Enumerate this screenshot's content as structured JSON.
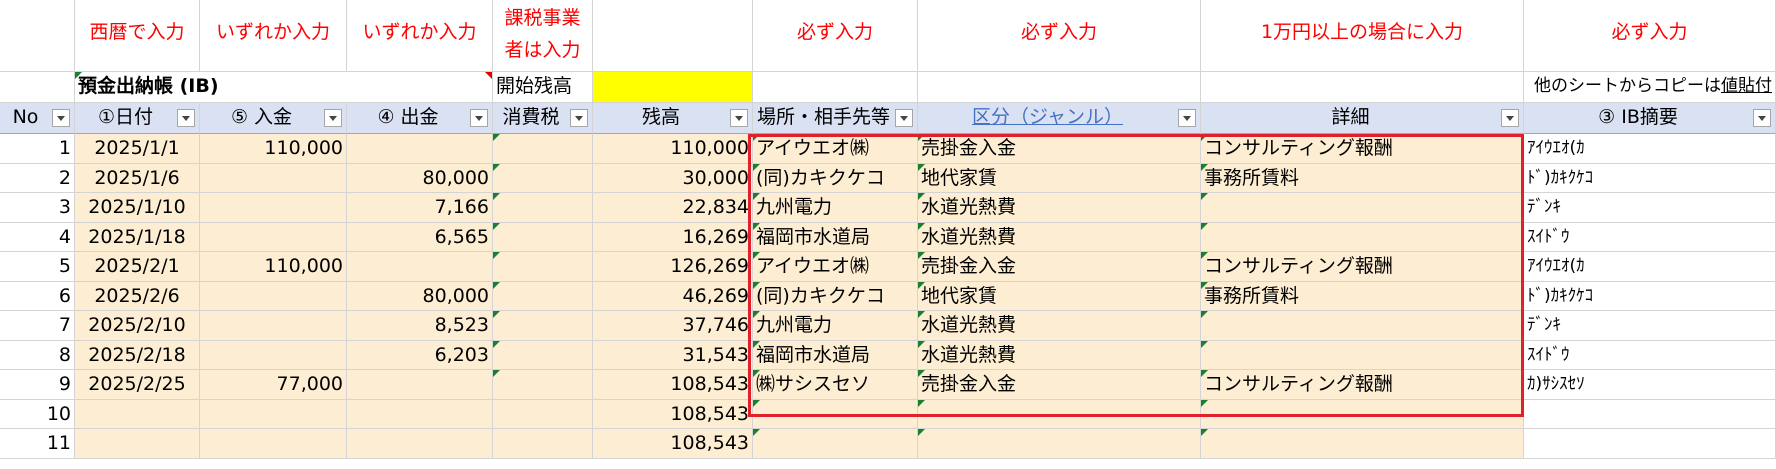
{
  "instructions": [
    "西暦で入力",
    "いずれか入力",
    "いずれか入力",
    "課税事業\n者は入力",
    "",
    "必ず入力",
    "必ず入力",
    "1万円以上の場合に入力",
    "必ず入力"
  ],
  "title_row": {
    "title": "預金出納帳 (IB)",
    "opening_label": "開始残高",
    "note_prefix": "他のシートからコピーは",
    "note_link": "値貼付"
  },
  "headers": [
    "No",
    "①日付",
    "⑤ 入金",
    "④ 出金",
    "消費税",
    "残高",
    "場所・相手先等",
    "区分（ジャンル）",
    "詳細",
    "③ IB摘要"
  ],
  "rows": [
    [
      "1",
      "2025/1/1",
      "110,000",
      "",
      "",
      "110,000",
      "アイウエオ㈱",
      "売掛金入金",
      "コンサルティング報酬",
      "ｱｲｳｴｵ(ｶ"
    ],
    [
      "2",
      "2025/1/6",
      "",
      "80,000",
      "",
      "30,000",
      "(同)カキクケコ",
      "地代家賃",
      "事務所賃料",
      "ﾄﾞ)ｶｷｸｹｺ"
    ],
    [
      "3",
      "2025/1/10",
      "",
      "7,166",
      "",
      "22,834",
      "九州電力",
      "水道光熱費",
      "",
      "ﾃﾞﾝｷ"
    ],
    [
      "4",
      "2025/1/18",
      "",
      "6,565",
      "",
      "16,269",
      "福岡市水道局",
      "水道光熱費",
      "",
      "ｽｲﾄﾞｳ"
    ],
    [
      "5",
      "2025/2/1",
      "110,000",
      "",
      "",
      "126,269",
      "アイウエオ㈱",
      "売掛金入金",
      "コンサルティング報酬",
      "ｱｲｳｴｵ(ｶ"
    ],
    [
      "6",
      "2025/2/6",
      "",
      "80,000",
      "",
      "46,269",
      "(同)カキクケコ",
      "地代家賃",
      "事務所賃料",
      "ﾄﾞ)ｶｷｸｹｺ"
    ],
    [
      "7",
      "2025/2/10",
      "",
      "8,523",
      "",
      "37,746",
      "九州電力",
      "水道光熱費",
      "",
      "ﾃﾞﾝｷ"
    ],
    [
      "8",
      "2025/2/18",
      "",
      "6,203",
      "",
      "31,543",
      "福岡市水道局",
      "水道光熱費",
      "",
      "ｽｲﾄﾞｳ"
    ],
    [
      "9",
      "2025/2/25",
      "77,000",
      "",
      "",
      "108,543",
      "㈱サシスセソ",
      "売掛金入金",
      "コンサルティング報酬",
      "ｶ)ｻｼｽｾｿ"
    ],
    [
      "10",
      "",
      "",
      "",
      "",
      "108,543",
      "",
      "",
      "",
      ""
    ],
    [
      "11",
      "",
      "",
      "",
      "",
      "108,543",
      "",
      "",
      "",
      ""
    ]
  ]
}
